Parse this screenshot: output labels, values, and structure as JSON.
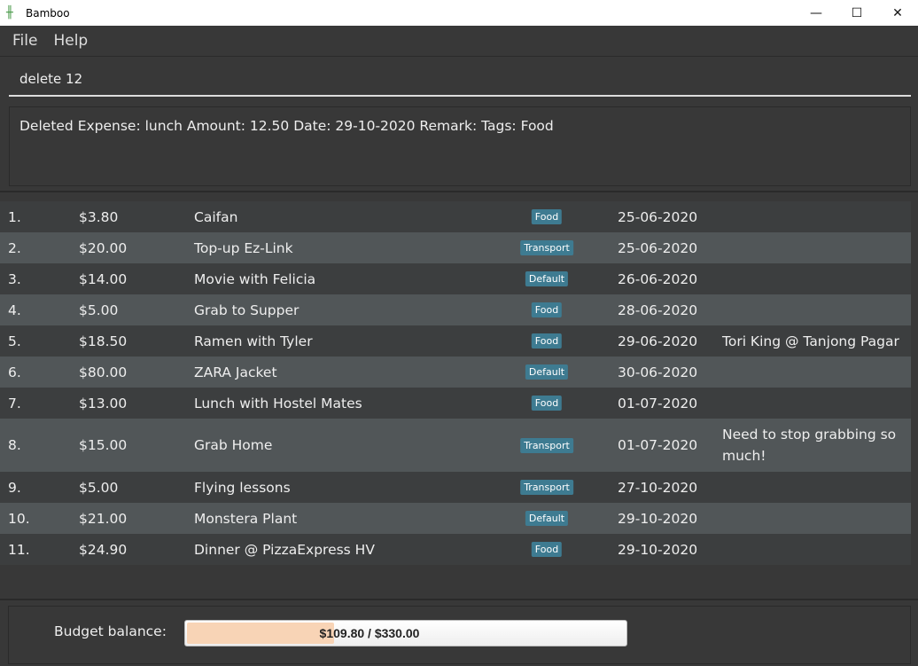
{
  "window": {
    "title": "Bamboo",
    "minimize": "—",
    "maximize": "☐",
    "close": "✕"
  },
  "menu": [
    "File",
    "Help"
  ],
  "command": {
    "value": "delete 12"
  },
  "result": "Deleted Expense: lunch Amount: 12.50 Date: 29-10-2020 Remark:  Tags: Food",
  "expenses": [
    {
      "index": "1.",
      "amount": "$3.80",
      "desc": "Caifan",
      "tag": "Food",
      "date": "25-06-2020",
      "remark": ""
    },
    {
      "index": "2.",
      "amount": "$20.00",
      "desc": "Top-up Ez-Link",
      "tag": "Transport",
      "date": "25-06-2020",
      "remark": ""
    },
    {
      "index": "3.",
      "amount": "$14.00",
      "desc": "Movie with Felicia",
      "tag": "Default",
      "date": "26-06-2020",
      "remark": ""
    },
    {
      "index": "4.",
      "amount": "$5.00",
      "desc": "Grab to Supper",
      "tag": "Food",
      "date": "28-06-2020",
      "remark": ""
    },
    {
      "index": "5.",
      "amount": "$18.50",
      "desc": "Ramen with Tyler",
      "tag": "Food",
      "date": "29-06-2020",
      "remark": "Tori King @ Tanjong Pagar"
    },
    {
      "index": "6.",
      "amount": "$80.00",
      "desc": "ZARA Jacket",
      "tag": "Default",
      "date": "30-06-2020",
      "remark": ""
    },
    {
      "index": "7.",
      "amount": "$13.00",
      "desc": "Lunch with Hostel Mates",
      "tag": "Food",
      "date": "01-07-2020",
      "remark": ""
    },
    {
      "index": "8.",
      "amount": "$15.00",
      "desc": "Grab Home",
      "tag": "Transport",
      "date": "01-07-2020",
      "remark": "Need to stop grabbing so much!"
    },
    {
      "index": "9.",
      "amount": "$5.00",
      "desc": "Flying lessons",
      "tag": "Transport",
      "date": "27-10-2020",
      "remark": ""
    },
    {
      "index": "10.",
      "amount": "$21.00",
      "desc": "Monstera Plant",
      "tag": "Default",
      "date": "29-10-2020",
      "remark": ""
    },
    {
      "index": "11.",
      "amount": "$24.90",
      "desc": "Dinner @ PizzaExpress HV",
      "tag": "Food",
      "date": "29-10-2020",
      "remark": ""
    }
  ],
  "budget": {
    "label": "Budget balance:",
    "text": "$109.80 / $330.00",
    "fraction": 0.333
  },
  "colors": {
    "tag": "#3e7b91",
    "fill": "#f8d4b6"
  }
}
